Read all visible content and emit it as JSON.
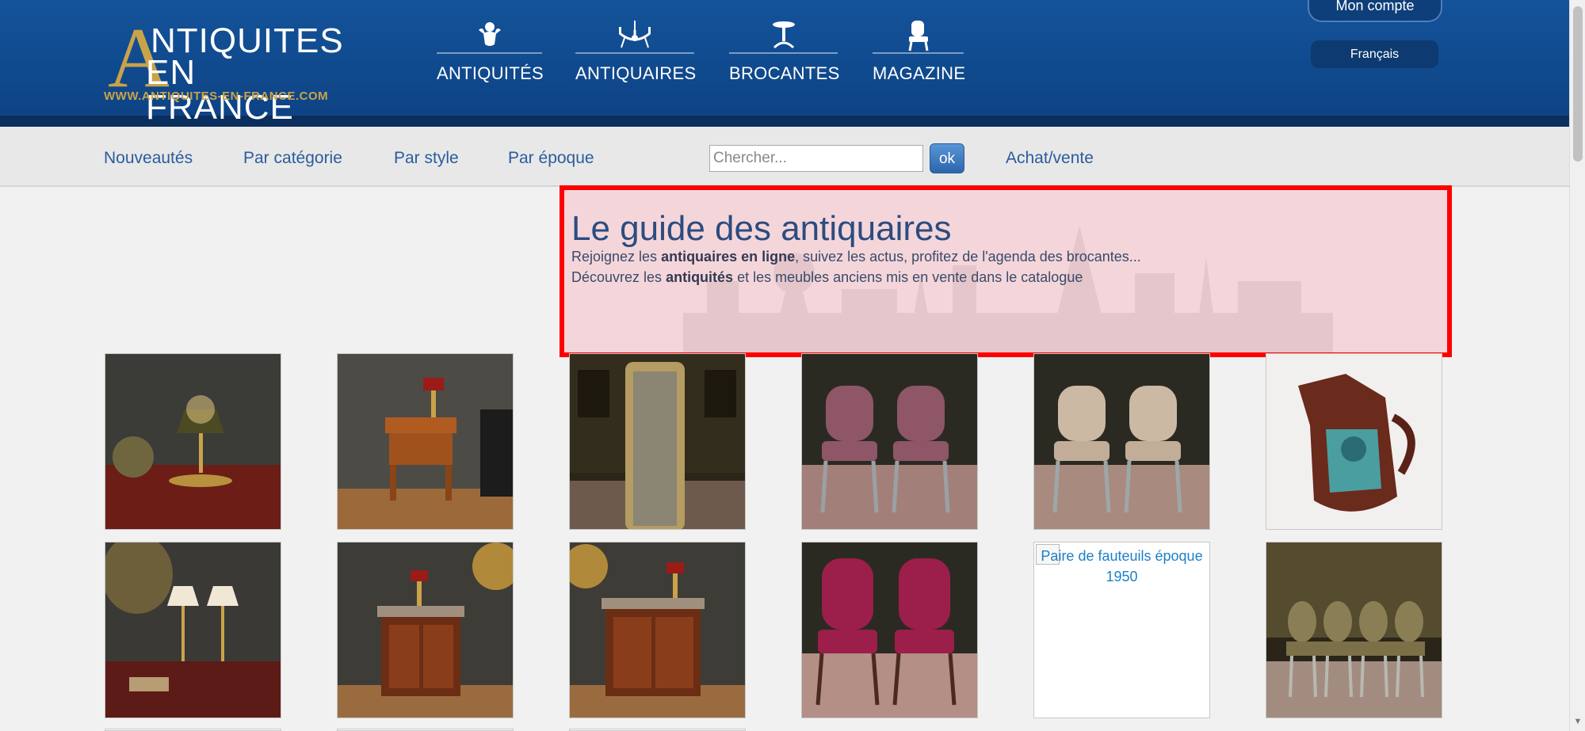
{
  "brand": {
    "logo_line1": "NTIQUITES",
    "logo_line2": "EN FRANCE",
    "logo_initial": "A",
    "logo_url": "WWW.ANTIQUITES-EN-FRANCE.COM"
  },
  "main_nav": [
    {
      "label": "ANTIQUITÉS",
      "icon": "cherub-icon"
    },
    {
      "label": "ANTIQUAIRES",
      "icon": "chandelier-icon"
    },
    {
      "label": "BROCANTES",
      "icon": "pedestal-table-icon"
    },
    {
      "label": "MAGAZINE",
      "icon": "armchair-icon"
    }
  ],
  "account": {
    "label": "Mon compte"
  },
  "language": {
    "label": "Français"
  },
  "sub_nav": [
    {
      "label": "Nouveautés"
    },
    {
      "label": "Par catégorie"
    },
    {
      "label": "Par style"
    },
    {
      "label": "Par époque"
    },
    {
      "label": "Achat/vente"
    }
  ],
  "search": {
    "placeholder": "Chercher...",
    "value": "",
    "button_label": "ok"
  },
  "guide": {
    "title": "Le guide des antiquaires",
    "line1_a": "Rejoignez les ",
    "line1_b": "antiquaires en ligne",
    "line1_c": ", suivez les actus, profitez de l'agenda des brocantes...",
    "line2_a": "Découvrez les ",
    "line2_b": "antiquités",
    "line2_c": " et les meubles anciens mis en vente dans le catalogue"
  },
  "products": [
    {
      "subject": "bouillotte-lamp",
      "alt": ""
    },
    {
      "subject": "bedside-table",
      "alt": ""
    },
    {
      "subject": "gilt-mirror",
      "alt": ""
    },
    {
      "subject": "pair-of-purple-chairs",
      "alt": ""
    },
    {
      "subject": "pair-of-cream-chairs",
      "alt": ""
    },
    {
      "subject": "majolica-pitcher",
      "alt": ""
    },
    {
      "subject": "pair-of-lamps",
      "alt": ""
    },
    {
      "subject": "corner-cabinet",
      "alt": ""
    },
    {
      "subject": "corner-cabinet",
      "alt": ""
    },
    {
      "subject": "pair-of-pink-armchairs",
      "alt": ""
    },
    {
      "subject": "broken-image",
      "alt": "Paire de fauteuils époque 1950"
    },
    {
      "subject": "set-of-four-chairs",
      "alt": ""
    }
  ],
  "colors": {
    "header_blue": "#14539a",
    "gold": "#c9a34a",
    "link_blue": "#2a5d9c",
    "highlight_red": "#ff0000"
  }
}
